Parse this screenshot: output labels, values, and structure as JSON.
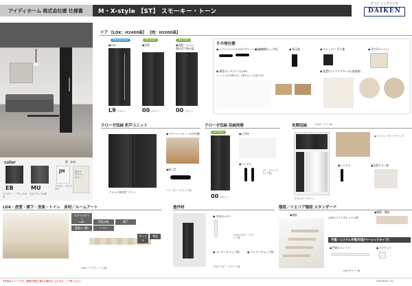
{
  "header": {
    "left_title": "アイディホーム 株式会社様 仕様書",
    "main_title": "M・X-style 【ST】 スモーキー・トーン",
    "logo_sub": "ずっと ここちいいを",
    "logo": "DAIKEN"
  },
  "color_section": {
    "title": "color",
    "side_label": "壁・床材",
    "chips": [
      {
        "code": "EB",
        "name": "アイボリー・ブラック木目"
      },
      {
        "code": "MU",
        "name": "モカブラック木目"
      },
      {
        "code": "JH",
        "name": "パウダー・ホワイト(JH)"
      }
    ],
    "extra_chip": "あかり\nホワイト\nカラー"
  },
  "door_section": {
    "title": "ドア 【LDK：H2400高】 【他：H2000高】",
    "doors": [
      {
        "tag": "Vertical Style",
        "label": "●LDK",
        "code": "L9",
        "suffix": "デザイン"
      },
      {
        "tag": "Tall Style",
        "label": "●洋室",
        "code": "00",
        "suffix": "デザイン"
      },
      {
        "tag": "Tall Style",
        "label": "●洗面・トイレ\n 間仕切り表示錠",
        "code": "00",
        "suffix": "デザイン"
      }
    ],
    "other_title": "その他仕様",
    "other_items": [
      "● レバーハンドル 85デザイン(ブラック色)",
      "● 角座(ブラック色)",
      "● 丸丁番(ブラック)",
      "● 表示錠",
      "● ストッパー 平丁番",
      "● 吊り戸(トイレ)",
      "● 戸当たり(ソフトクローズ)",
      "● 静音ラッチ(ケース)(SP)",
      "● 錠受け(ソフトクローズ)(各部屋)"
    ],
    "other_note": "バーンと大きな音を出して閉まることを防ぎます。",
    "lever_color": "ブラック"
  },
  "closet_section": {
    "title": "クローゼ収納 折戸ユニット",
    "label": "フラット枠木目",
    "suffix": "デザイン",
    "feature1": "●フリーレールノースタ仕様",
    "feature2": "●取っ手",
    "feature2_note": "ツル・ダミー(ブラック色)"
  },
  "closet2_section": {
    "title": "クローゼ収納 収納持扉",
    "tag": "Tall Style",
    "code": "00",
    "suffix": "デザイン",
    "item1": "●三方枠",
    "item2": "●ハンドル",
    "item2_note": "ツル・ダミー(ブラック色)"
  },
  "entry_section": {
    "title": "玄関収納",
    "sub": "コの字・ミラー扉",
    "label": "フラット",
    "suffix": "デザイン",
    "item1": "●ハンドル",
    "item2": "●全面ミラー扉",
    "item3": "●ハンドル・ダミー(ブラック)"
  },
  "floor_section": {
    "title": "LDK・居室・廊下・洗面・トイレ　床材／ルームアート",
    "tabs": [
      "スタイルタイプ",
      "LDK",
      "洋室(6帖)",
      "廊下",
      "洗面(2.4畳)",
      "トイレ"
    ],
    "floor_label": "(WM)ソフトグレージュ柄",
    "sample_btn": "サンプル",
    "sample_btn2": "単品"
  },
  "skylight_section": {
    "title": "造作材",
    "item1": "● 巾木(H=57)",
    "item2": "● コーナーキャップ材",
    "item3": "● コーナーキャップ材",
    "color1": "(OH)パウダー・ホワイト柄",
    "color2": "(OH)パウダー・ホワイト柄"
  },
  "stair_section": {
    "title": "階段／イエリア階段 スタンダード",
    "label": "●踏板",
    "sub": "(WM)ソフトグレージュ柄",
    "right_label": "●踊場・踏板",
    "railing_title": "手摺／システム手摺35型(ベーシックタイプ)",
    "rail1": "●手摺ストレート",
    "rail2": "●ブラケット",
    "rail_color": "(WH)ホワイト柄"
  },
  "footer": {
    "note": "※写真はイメージです。実際の商品と異なる場合がございます。ご了承ください。",
    "code": "S2607B76-1-02"
  }
}
